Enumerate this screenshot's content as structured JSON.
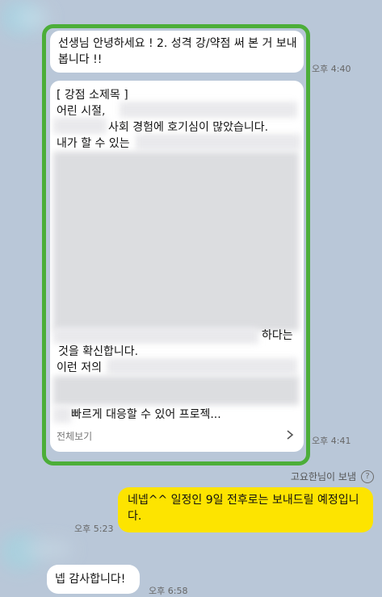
{
  "messages": {
    "incoming1_text": "선생님 안녕하세요 ! 2. 성격  강/약점 써 본 거 보내봅니다 !!",
    "incoming1_time": "오후 4:40",
    "card": {
      "line1": "[ 강점 소제목 ]",
      "line2": "어린 시절,",
      "line3": "사회 경험에 호기심이 많았습니다.",
      "line4": "내가 할 수 있는",
      "line5": "하다는",
      "line6": "것을 확신합니다.",
      "line7": "이런 저의",
      "line8": "빠르게 대응할 수 있어 프로젝...",
      "footer_label": "전체보기"
    },
    "incoming2_time": "오후 4:41",
    "read_status": "고요한님이 보냄",
    "outgoing_text": "네넵^^ 일정인 9일 전후로는 보내드릴 예정입니다.",
    "outgoing_time": "오후 5:23",
    "incoming3_text": "넵 감사합니다!",
    "incoming3_time": "오후 6:58"
  },
  "colors": {
    "background": "#b9c7d8",
    "highlight_frame": "#4cae39",
    "outgoing_bubble": "#fde400",
    "incoming_bubble": "#ffffff"
  },
  "icons": [
    "help-circle-icon",
    "chevron-right-icon"
  ]
}
